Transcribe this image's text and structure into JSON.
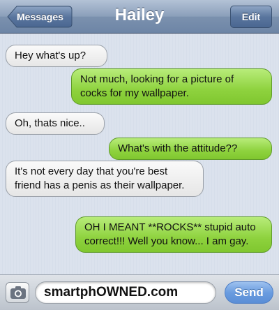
{
  "header": {
    "back_label": "Messages",
    "title": "Hailey",
    "edit_label": "Edit"
  },
  "messages": [
    {
      "side": "received",
      "text": "Hey what's up?"
    },
    {
      "side": "sent",
      "text": "Not much, looking for a picture of cocks for my wallpaper."
    },
    {
      "side": "received",
      "text": "Oh, thats nice.."
    },
    {
      "side": "sent",
      "text": "What's with the attitude??"
    },
    {
      "side": "received",
      "text": "It's not every day that you're best friend has a penis as their wallpaper."
    },
    {
      "side": "sent",
      "text": "OH I MEANT **ROCKS** stupid auto correct!!! Well you know... I am gay."
    }
  ],
  "composer": {
    "field_text": "smartphOWNED.com",
    "send_label": "Send",
    "camera_icon": "camera-icon"
  }
}
